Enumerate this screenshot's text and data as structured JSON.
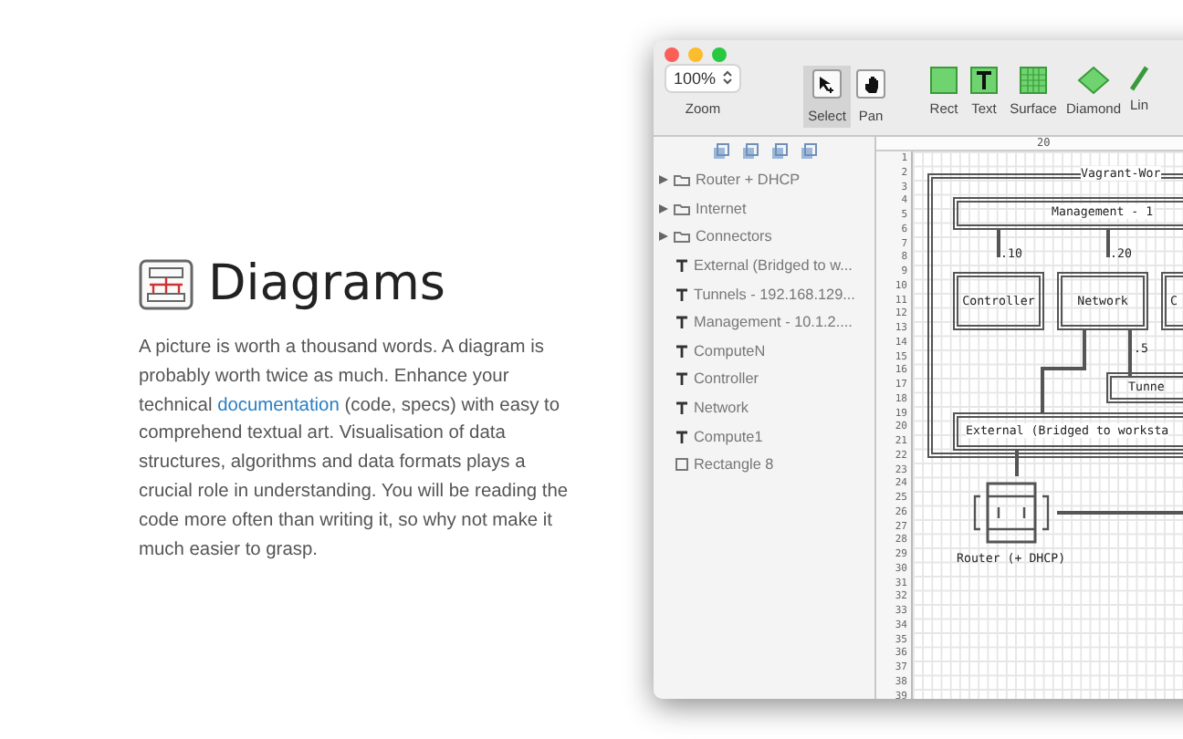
{
  "intro": {
    "title": "Diagrams",
    "paragraph_before": "A picture is worth a thousand words. A diagram is probably worth twice as much. Enhance your technical",
    "link": "documentation",
    "paragraph_after": "(code, specs) with easy to comprehend textual art. Visualisation of data structures, algorithms and data formats plays a crucial role in understanding. You will be reading the code more often than writing it, so why not make it much easier to grasp."
  },
  "toolbar": {
    "zoom": {
      "value": "100%",
      "label": "Zoom"
    },
    "tools": [
      {
        "label": "Select",
        "kind": "select",
        "selected": true
      },
      {
        "label": "Pan",
        "kind": "pan",
        "selected": false
      }
    ],
    "shapes": [
      {
        "label": "Rect",
        "kind": "rect"
      },
      {
        "label": "Text",
        "kind": "text"
      },
      {
        "label": "Surface",
        "kind": "surface"
      },
      {
        "label": "Diamond",
        "kind": "diamond"
      },
      {
        "label": "Lin",
        "kind": "line"
      }
    ]
  },
  "sidebar": {
    "items": [
      {
        "label": "Router + DHCP",
        "kind": "folder",
        "expanded": false
      },
      {
        "label": "Internet",
        "kind": "folder",
        "expanded": false
      },
      {
        "label": "Connectors",
        "kind": "folder",
        "expanded": false
      },
      {
        "label": "External (Bridged to w...",
        "kind": "text"
      },
      {
        "label": "Tunnels - 192.168.129...",
        "kind": "text"
      },
      {
        "label": "Management - 10.1.2....",
        "kind": "text"
      },
      {
        "label": "ComputeN",
        "kind": "text"
      },
      {
        "label": "Controller",
        "kind": "text"
      },
      {
        "label": "Network",
        "kind": "text"
      },
      {
        "label": "Compute1",
        "kind": "text"
      },
      {
        "label": "Rectangle 8",
        "kind": "rect"
      }
    ]
  },
  "canvas": {
    "ruler_label": "20",
    "line_numbers": [
      "1",
      "2",
      "3",
      "4",
      "5",
      "6",
      "7",
      "8",
      "9",
      "10",
      "11",
      "12",
      "13",
      "14",
      "15",
      "16",
      "17",
      "18",
      "19",
      "20",
      "21",
      "22",
      "23",
      "24",
      "25",
      "26",
      "27",
      "28",
      "29",
      "30",
      "31",
      "32",
      "33",
      "34",
      "35",
      "36",
      "37",
      "38",
      "39"
    ],
    "group_label": "Vagrant-Wor",
    "management_label": "Management - 1",
    "address_labels": [
      ".10",
      ".20",
      ".5"
    ],
    "nodes": [
      "Controller",
      "Network",
      "C"
    ],
    "tunnels_label": "Tunne",
    "external_label": "External (Bridged to worksta",
    "router_label": "Router (+ DHCP)"
  }
}
